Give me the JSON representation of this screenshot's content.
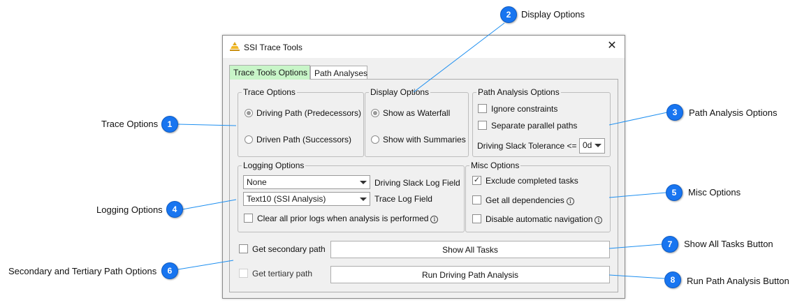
{
  "window": {
    "title": "SSI Trace Tools",
    "close_symbol": "✕",
    "app_icon": "ssi-logo-icon"
  },
  "tabs": [
    {
      "label": "Trace Tools Options",
      "active": true
    },
    {
      "label": "Path Analyses",
      "active": false
    }
  ],
  "trace_options": {
    "legend": "Trace Options",
    "options": [
      {
        "label": "Driving Path (Predecessors)",
        "checked": true
      },
      {
        "label": "Driven Path (Successors)",
        "checked": false
      }
    ]
  },
  "display_options": {
    "legend": "Display Options",
    "options": [
      {
        "label": "Show as Waterfall",
        "checked": true
      },
      {
        "label": "Show with Summaries",
        "checked": false
      }
    ]
  },
  "path_analysis_options": {
    "legend": "Path Analysis Options",
    "checkboxes": [
      {
        "label": "Ignore constraints",
        "checked": false
      },
      {
        "label": "Separate parallel paths",
        "checked": false
      }
    ],
    "tolerance_label": "Driving Slack Tolerance <=",
    "tolerance_value": "0d"
  },
  "logging_options": {
    "legend": "Logging Options",
    "driving_slack_field_value": "None",
    "driving_slack_field_label": "Driving Slack Log Field",
    "trace_log_field_value": "Text10 (SSI Analysis)",
    "trace_log_field_label": "Trace Log Field",
    "clear_logs_label": "Clear all prior logs when analysis is performed",
    "clear_logs_checked": false
  },
  "misc_options": {
    "legend": "Misc Options",
    "checkboxes": [
      {
        "label": "Exclude completed tasks",
        "checked": true,
        "info": false
      },
      {
        "label": "Get all dependencies",
        "checked": false,
        "info": true
      },
      {
        "label": "Disable automatic navigation",
        "checked": false,
        "info": true
      }
    ]
  },
  "bottom": {
    "secondary_path_label": "Get secondary path",
    "secondary_path_checked": false,
    "tertiary_path_label": "Get tertiary path",
    "tertiary_path_checked": false,
    "show_all_tasks_button": "Show All Tasks",
    "run_analysis_button": "Run Driving Path Analysis"
  },
  "info_symbol": "i",
  "check_symbol": "✓",
  "callouts": [
    {
      "number": "1",
      "text": "Trace Options"
    },
    {
      "number": "2",
      "text": "Display Options"
    },
    {
      "number": "3",
      "text": "Path Analysis Options"
    },
    {
      "number": "4",
      "text": "Logging Options"
    },
    {
      "number": "5",
      "text": "Misc Options"
    },
    {
      "number": "6",
      "text": "Secondary and Tertiary Path Options"
    },
    {
      "number": "7",
      "text": "Show All Tasks Button"
    },
    {
      "number": "8",
      "text": "Run Path Analysis Button"
    }
  ],
  "colors": {
    "callout_blue": "#1875f0",
    "leader_line": "#1e8ff0",
    "active_tab": "#c8f5c8"
  }
}
